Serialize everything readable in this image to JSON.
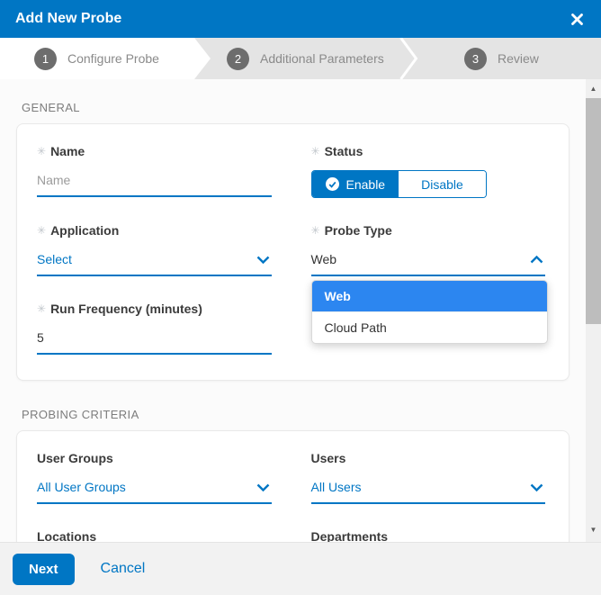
{
  "required_marker": "✳",
  "header": {
    "title": "Add New Probe"
  },
  "stepper": {
    "steps": [
      {
        "number": "1",
        "label": "Configure Probe",
        "active": true
      },
      {
        "number": "2",
        "label": "Additional Parameters",
        "active": false
      },
      {
        "number": "3",
        "label": "Review",
        "active": false
      }
    ]
  },
  "sections": {
    "general": {
      "title": "GENERAL",
      "fields": {
        "name": {
          "label": "Name",
          "required": true,
          "placeholder": "Name",
          "value": ""
        },
        "status": {
          "label": "Status",
          "required": true,
          "options": [
            "Enable",
            "Disable"
          ],
          "selected": "Enable"
        },
        "application": {
          "label": "Application",
          "required": true,
          "value": "Select"
        },
        "probe_type": {
          "label": "Probe Type",
          "required": true,
          "value": "Web",
          "open": true,
          "options": [
            "Web",
            "Cloud Path"
          ],
          "highlighted": "Web"
        },
        "run_frequency": {
          "label": "Run Frequency (minutes)",
          "required": true,
          "value": "5"
        }
      }
    },
    "probing_criteria": {
      "title": "PROBING CRITERIA",
      "fields": {
        "user_groups": {
          "label": "User Groups",
          "value": "All User Groups"
        },
        "users": {
          "label": "Users",
          "value": "All Users"
        },
        "locations": {
          "label": "Locations"
        },
        "departments": {
          "label": "Departments"
        }
      }
    }
  },
  "footer": {
    "next_label": "Next",
    "cancel_label": "Cancel"
  },
  "scrollbar": {
    "up_arrow": "▲",
    "down_arrow": "▼"
  },
  "colors": {
    "header_blue": "#0076C4",
    "dropdown_highlight_blue": "#2C86F0",
    "stepper_gray": "#e4e4e4",
    "step_circle_gray": "#6d6d6d"
  }
}
